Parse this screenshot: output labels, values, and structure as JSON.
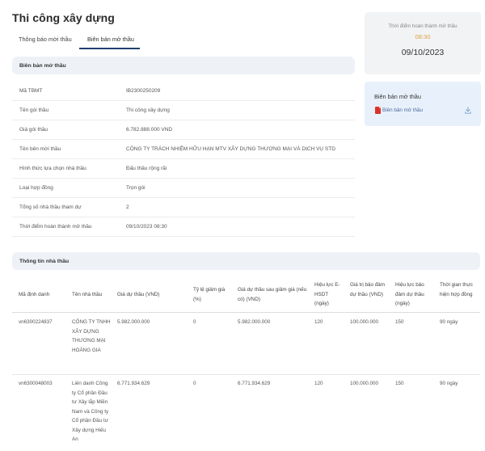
{
  "page": {
    "title": "Thi công xây dựng"
  },
  "tabs": [
    {
      "label": "Thông báo mời thầu"
    },
    {
      "label": "Biên bản mở thầu"
    }
  ],
  "section1": {
    "title": "Biên bản mở thầu"
  },
  "info": [
    {
      "label": "Mã TBMT",
      "value": "IB2300250209"
    },
    {
      "label": "Tên gói thầu",
      "value": "Thi công xây dựng"
    },
    {
      "label": "Giá gói thầu",
      "value": "6.782.888.000 VND"
    },
    {
      "label": "Tên bên mời thầu",
      "value": "CÔNG TY TRÁCH NHIỆM HỮU HẠN MTV XÂY DỰNG THƯƠNG MẠI VÀ DỊCH VỤ STD"
    },
    {
      "label": "Hình thức lựa chọn nhà thầu",
      "value": "Đấu thầu rộng rãi"
    },
    {
      "label": "Loại hợp đồng",
      "value": "Trọn gói"
    },
    {
      "label": "Tổng số nhà thầu tham dự",
      "value": "2"
    },
    {
      "label": "Thời điểm hoàn thành mở thầu",
      "value": "09/10/2023 08:30"
    }
  ],
  "side": {
    "completion_label": "Thời điểm hoàn thành mở thầu",
    "completion_time": "08:30",
    "completion_date": "09/10/2023",
    "doc_title": "Biên bản mở thầu",
    "doc_link": "Biên bản mở thầu",
    "pdf_color": "#d9322b",
    "time_color": "#e0a040"
  },
  "section2": {
    "title": "Thông tin nhà thầu"
  },
  "bid_table": {
    "headers": [
      "Mã định danh",
      "Tên nhà thầu",
      "Giá dự thầu (VND)",
      "Tỷ lệ giảm giá (%)",
      "Giá dự thầu sau giảm giá (nếu có) (VND)",
      "Hiệu lực E-HSDT (ngày)",
      "Giá trị bảo đảm dự thầu (VND)",
      "Hiệu lực bảo đảm dự thầu (ngày)",
      "Thời gian thực hiện hợp đồng"
    ],
    "rows": [
      [
        "vn6300224837",
        "CÔNG TY TNHH XÂY DỰNG THƯƠNG MẠI HOÀNG GIA",
        "5.982.000.000",
        "0",
        "5.982.000.000",
        "120",
        "100.000.000",
        "150",
        "90 ngày"
      ],
      [
        "vn6300048003",
        "Liên danh Công ty Cổ phần Đầu tư Xây lắp Miền Nam và Công ty Cổ phần Đầu tư Xây dựng Hiếu An",
        "6.771.934.629",
        "0",
        "6.771.934.629",
        "120",
        "100.000.000",
        "150",
        "90 ngày"
      ]
    ]
  }
}
